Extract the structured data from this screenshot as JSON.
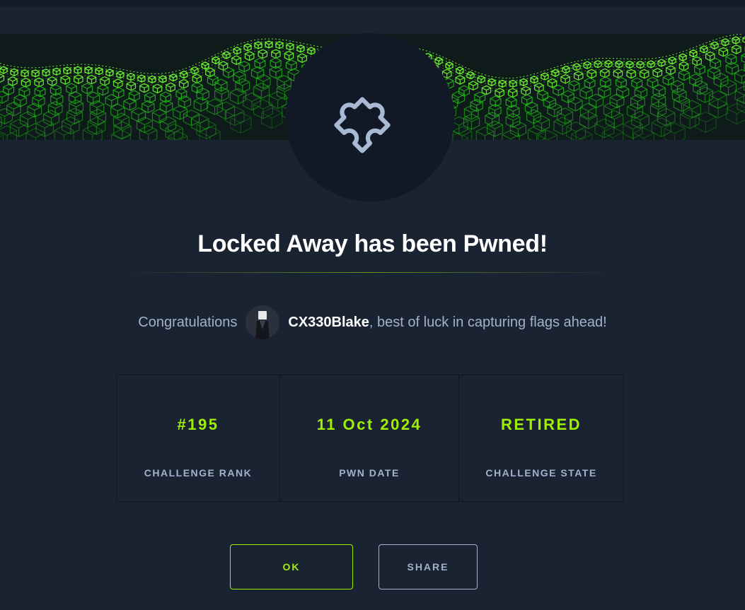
{
  "title": "Locked Away has been Pwned!",
  "congrats": {
    "prefix": "Congratulations",
    "username": "CX330Blake",
    "suffix": ", best of luck in capturing flags ahead!"
  },
  "stats": [
    {
      "value": "#195",
      "label": "CHALLENGE RANK"
    },
    {
      "value": "11 Oct 2024",
      "label": "PWN DATE"
    },
    {
      "value": "RETIRED",
      "label": "CHALLENGE STATE"
    }
  ],
  "buttons": {
    "ok_label": "OK",
    "share_label": "SHARE"
  },
  "icons": {
    "challenge": "puzzle-piece-icon",
    "avatar": "user-avatar"
  },
  "colors": {
    "background": "#1a2332",
    "accent": "#9fef00",
    "muted_text": "#a4b1cd",
    "icon_circle": "#111927"
  }
}
